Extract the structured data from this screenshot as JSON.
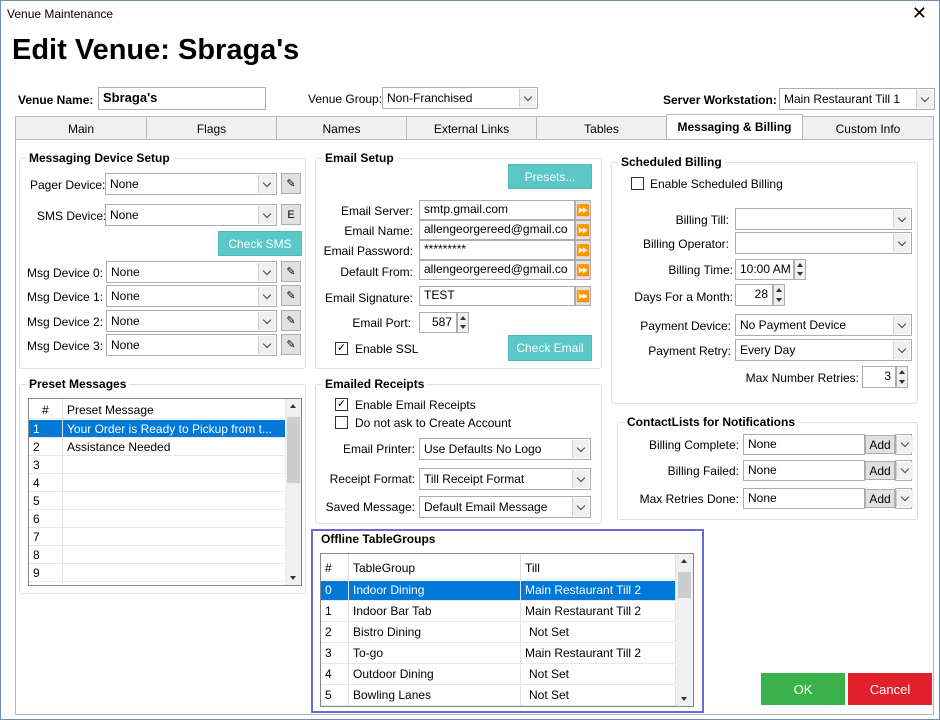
{
  "window": {
    "title": "Venue Maintenance",
    "close_glyph": "✕"
  },
  "heading": "Edit Venue: Sbraga's",
  "top": {
    "venue_name_label": "Venue Name:",
    "venue_name_value": "Sbraga's",
    "venue_group_label": "Venue Group:",
    "venue_group_value": "Non-Franchised",
    "server_ws_label": "Server Workstation:",
    "server_ws_value": "Main Restaurant Till 1"
  },
  "tabs": [
    "Main",
    "Flags",
    "Names",
    "External Links",
    "Tables",
    "Messaging & Billing",
    "Custom Info"
  ],
  "active_tab": "Messaging & Billing",
  "messaging": {
    "title": "Messaging Device Setup",
    "pager_label": "Pager Device:",
    "pager_value": "None",
    "sms_label": "SMS Device:",
    "sms_value": "None",
    "sms_e": "E",
    "check_sms": "Check SMS",
    "devices": [
      {
        "label": "Msg Device 0:",
        "value": "None"
      },
      {
        "label": "Msg Device 1:",
        "value": "None"
      },
      {
        "label": "Msg Device 2:",
        "value": "None"
      },
      {
        "label": "Msg Device 3:",
        "value": "None"
      }
    ]
  },
  "preset": {
    "title": "Preset Messages",
    "col_num": "#",
    "col_msg": "Preset Message",
    "rows": [
      {
        "n": "1",
        "m": "Your Order is Ready to Pickup from t..."
      },
      {
        "n": "2",
        "m": "Assistance Needed"
      },
      {
        "n": "3",
        "m": ""
      },
      {
        "n": "4",
        "m": ""
      },
      {
        "n": "5",
        "m": ""
      },
      {
        "n": "6",
        "m": ""
      },
      {
        "n": "7",
        "m": ""
      },
      {
        "n": "8",
        "m": ""
      },
      {
        "n": "9",
        "m": ""
      }
    ]
  },
  "email": {
    "title": "Email Setup",
    "presets": "Presets...",
    "server_label": "Email Server:",
    "server_value": "smtp.gmail.com",
    "name_label": "Email Name:",
    "name_value": "allengeorgereed@gmail.co",
    "password_label": "Email Password:",
    "password_value": "*********",
    "from_label": "Default From:",
    "from_value": "allengeorgereed@gmail.co",
    "signature_label": "Email Signature:",
    "signature_value": "TEST",
    "port_label": "Email Port:",
    "port_value": "587",
    "ssl_label": "Enable SSL",
    "ssl_checked": true,
    "check_email": "Check Email"
  },
  "receipts": {
    "title": "Emailed Receipts",
    "enable_label": "Enable Email Receipts",
    "enable_checked": true,
    "no_account_label": "Do not ask to Create Account",
    "no_account_checked": false,
    "printer_label": "Email Printer:",
    "printer_value": "Use Defaults No Logo",
    "format_label": "Receipt Format:",
    "format_value": "Till Receipt Format",
    "saved_label": "Saved Message:",
    "saved_value": "Default Email Message"
  },
  "offline": {
    "title": "Offline TableGroups",
    "col_num": "#",
    "col_group": "TableGroup",
    "col_till": "Till",
    "rows": [
      {
        "n": "0",
        "g": "Indoor Dining",
        "t": "Main Restaurant Till 2"
      },
      {
        "n": "1",
        "g": "Indoor Bar Tab",
        "t": "Main Restaurant Till 2"
      },
      {
        "n": "2",
        "g": "Bistro Dining",
        "t": "Not Set"
      },
      {
        "n": "3",
        "g": "To-go",
        "t": "Main Restaurant Till 2"
      },
      {
        "n": "4",
        "g": "Outdoor Dining",
        "t": "Not Set"
      },
      {
        "n": "5",
        "g": "Bowling Lanes",
        "t": "Not Set"
      }
    ]
  },
  "billing": {
    "title": "Scheduled Billing",
    "enable_label": "Enable Scheduled Billing",
    "enable_checked": false,
    "till_label": "Billing Till:",
    "till_value": "",
    "operator_label": "Billing Operator:",
    "operator_value": "",
    "time_label": "Billing Time:",
    "time_value": "10:00 AM",
    "days_label": "Days For a Month:",
    "days_value": "28",
    "payment_label": "Payment Device:",
    "payment_value": "No Payment Device",
    "retry_label": "Payment Retry:",
    "retry_value": "Every Day",
    "max_label": "Max Number Retries:",
    "max_value": "3"
  },
  "contacts": {
    "title": "ContactLists for Notifications",
    "add_label": "Add",
    "rows": [
      {
        "label": "Billing Complete:",
        "value": "None"
      },
      {
        "label": "Billing Failed:",
        "value": "None"
      },
      {
        "label": "Max Retries Done:",
        "value": "None"
      }
    ]
  },
  "buttons": {
    "ok": "OK",
    "cancel": "Cancel"
  },
  "colors": {
    "accent_teal": "#5bc8c8",
    "selection": "#0078d7",
    "ok": "#3cb34a",
    "cancel": "#e2202c",
    "highlight_border": "#6a6ad0"
  }
}
